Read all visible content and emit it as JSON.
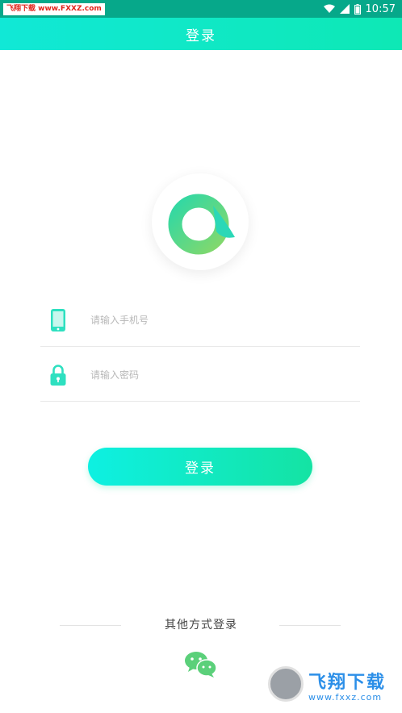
{
  "status_bar": {
    "watermark": "飞翔下载 www.FXXZ.com",
    "time": "10:57",
    "icons": [
      "wifi-icon",
      "signal-icon",
      "battery-icon"
    ]
  },
  "header": {
    "title": "登录"
  },
  "logo": {
    "icon": "app-logo-icon"
  },
  "form": {
    "phone": {
      "placeholder": "请输入手机号",
      "value": "",
      "icon": "phone-icon"
    },
    "password": {
      "placeholder": "请输入密码",
      "value": "",
      "icon": "lock-icon"
    }
  },
  "login_button": {
    "label": "登录"
  },
  "other_login": {
    "title": "其他方式登录",
    "icon": "wechat-icon"
  },
  "bottom_watermark": {
    "brand": "飞翔下载",
    "url": "www.fxxz.com"
  },
  "colors": {
    "accent_start": "#11e8d6",
    "accent_end": "#14e3a3",
    "status_bar": "#06a88a",
    "placeholder": "#b8b8b8",
    "wechat": "#5bd07a"
  }
}
